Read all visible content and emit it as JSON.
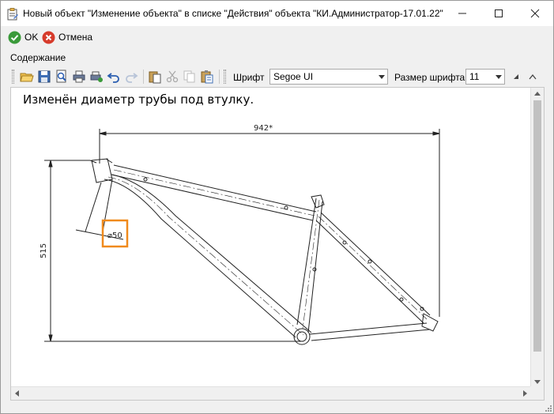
{
  "window": {
    "title": "Новый объект \"Изменение объекта\" в списке \"Действия\" объекта \"КИ.Администратор-17.01.22\""
  },
  "commands": {
    "ok_label": "OK",
    "cancel_label": "Отмена"
  },
  "content": {
    "section_label": "Содержание",
    "toolbar": {
      "font_label": "Шрифт",
      "font_value": "Segoe UI",
      "size_label": "Размер шрифта",
      "size_value": "11"
    },
    "text": "Изменён диаметр трубы под втулку.",
    "drawing": {
      "dim_length": "942*",
      "dim_height": "515",
      "dim_diameter": "⌀50",
      "highlight_color": "#f08a1c"
    }
  },
  "colors": {
    "ok_green": "#3a9a3a",
    "cancel_red": "#d63b2b"
  }
}
